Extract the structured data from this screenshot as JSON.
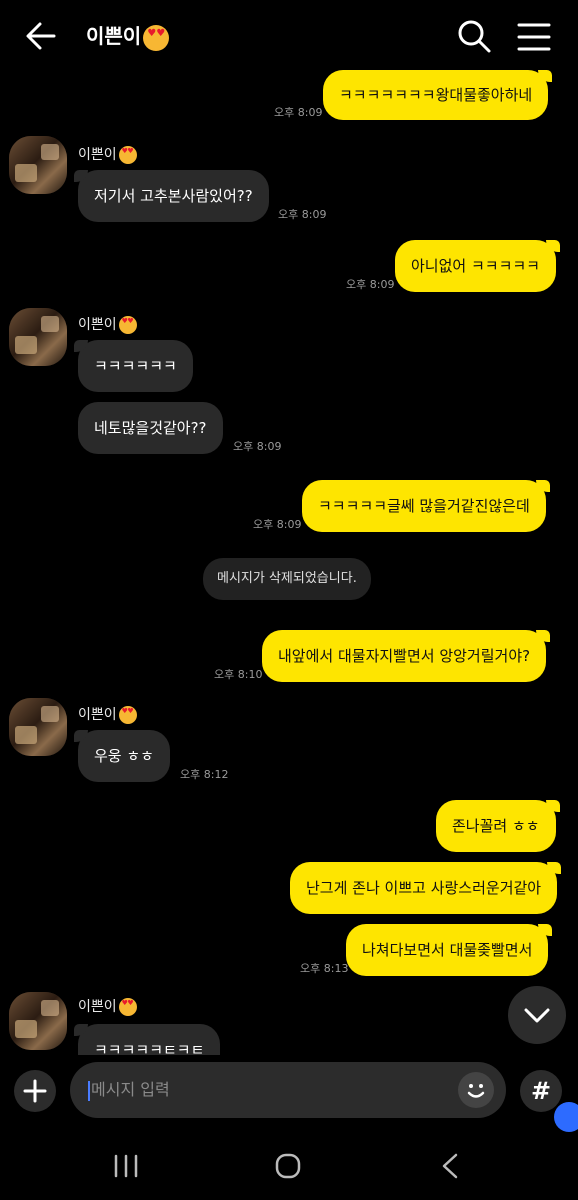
{
  "header": {
    "title": "이쁜이",
    "back_icon": "arrow-left-icon",
    "search_icon": "search-icon",
    "menu_icon": "hamburger-menu-icon"
  },
  "contact": {
    "name": "이쁜이",
    "emoji": "heart-eyes-emoji"
  },
  "messages": [
    {
      "sender": "me",
      "text": "ㅋㅋㅋㅋㅋㅋㅋ왕대물좋아하네",
      "time": "오후 8:09"
    },
    {
      "sender": "them",
      "text": "저기서 고추본사람있어??",
      "time": "오후 8:09"
    },
    {
      "sender": "me",
      "text": "아니없어 ㅋㅋㅋㅋㅋ",
      "time": "오후 8:09"
    },
    {
      "sender": "them",
      "text": "ㅋㅋㅋㅋㅋㅋ",
      "time": ""
    },
    {
      "sender": "them",
      "text": "네토많을것같아??",
      "time": "오후 8:09"
    },
    {
      "sender": "me",
      "text": "ㅋㅋㅋㅋㅋ글쎄 많을거같진않은데",
      "time": "오후 8:09"
    },
    {
      "sender": "system",
      "text": "메시지가 삭제되었습니다.",
      "time": ""
    },
    {
      "sender": "me",
      "text": "내앞에서 대물자지빨면서 앙앙거릴거야?",
      "time": "오후 8:10"
    },
    {
      "sender": "them",
      "text": "우웅 ㅎㅎ",
      "time": "오후 8:12"
    },
    {
      "sender": "me",
      "text": "존나꼴려 ㅎㅎ",
      "time": ""
    },
    {
      "sender": "me",
      "text": "난그게 존나 이쁘고 사랑스러운거같아",
      "time": ""
    },
    {
      "sender": "me",
      "text": "나쳐다보면서 대물좆빨면서",
      "time": "오후 8:13"
    },
    {
      "sender": "them",
      "text": "ㅋㅋㅋㅋㅋㅌㅋㅌ",
      "time": ""
    }
  ],
  "input": {
    "placeholder": "메시지 입력",
    "plus_icon": "plus-icon",
    "emoji_icon": "smiley-icon",
    "hash_label": "#"
  },
  "nav": {
    "recent_icon": "recent-apps-icon",
    "home_icon": "home-icon",
    "back_icon": "back-chevron-icon"
  },
  "colors": {
    "my_bubble": "#fee500",
    "their_bubble": "#2a2a2a",
    "background": "#000000",
    "accent": "#2d6bff"
  }
}
